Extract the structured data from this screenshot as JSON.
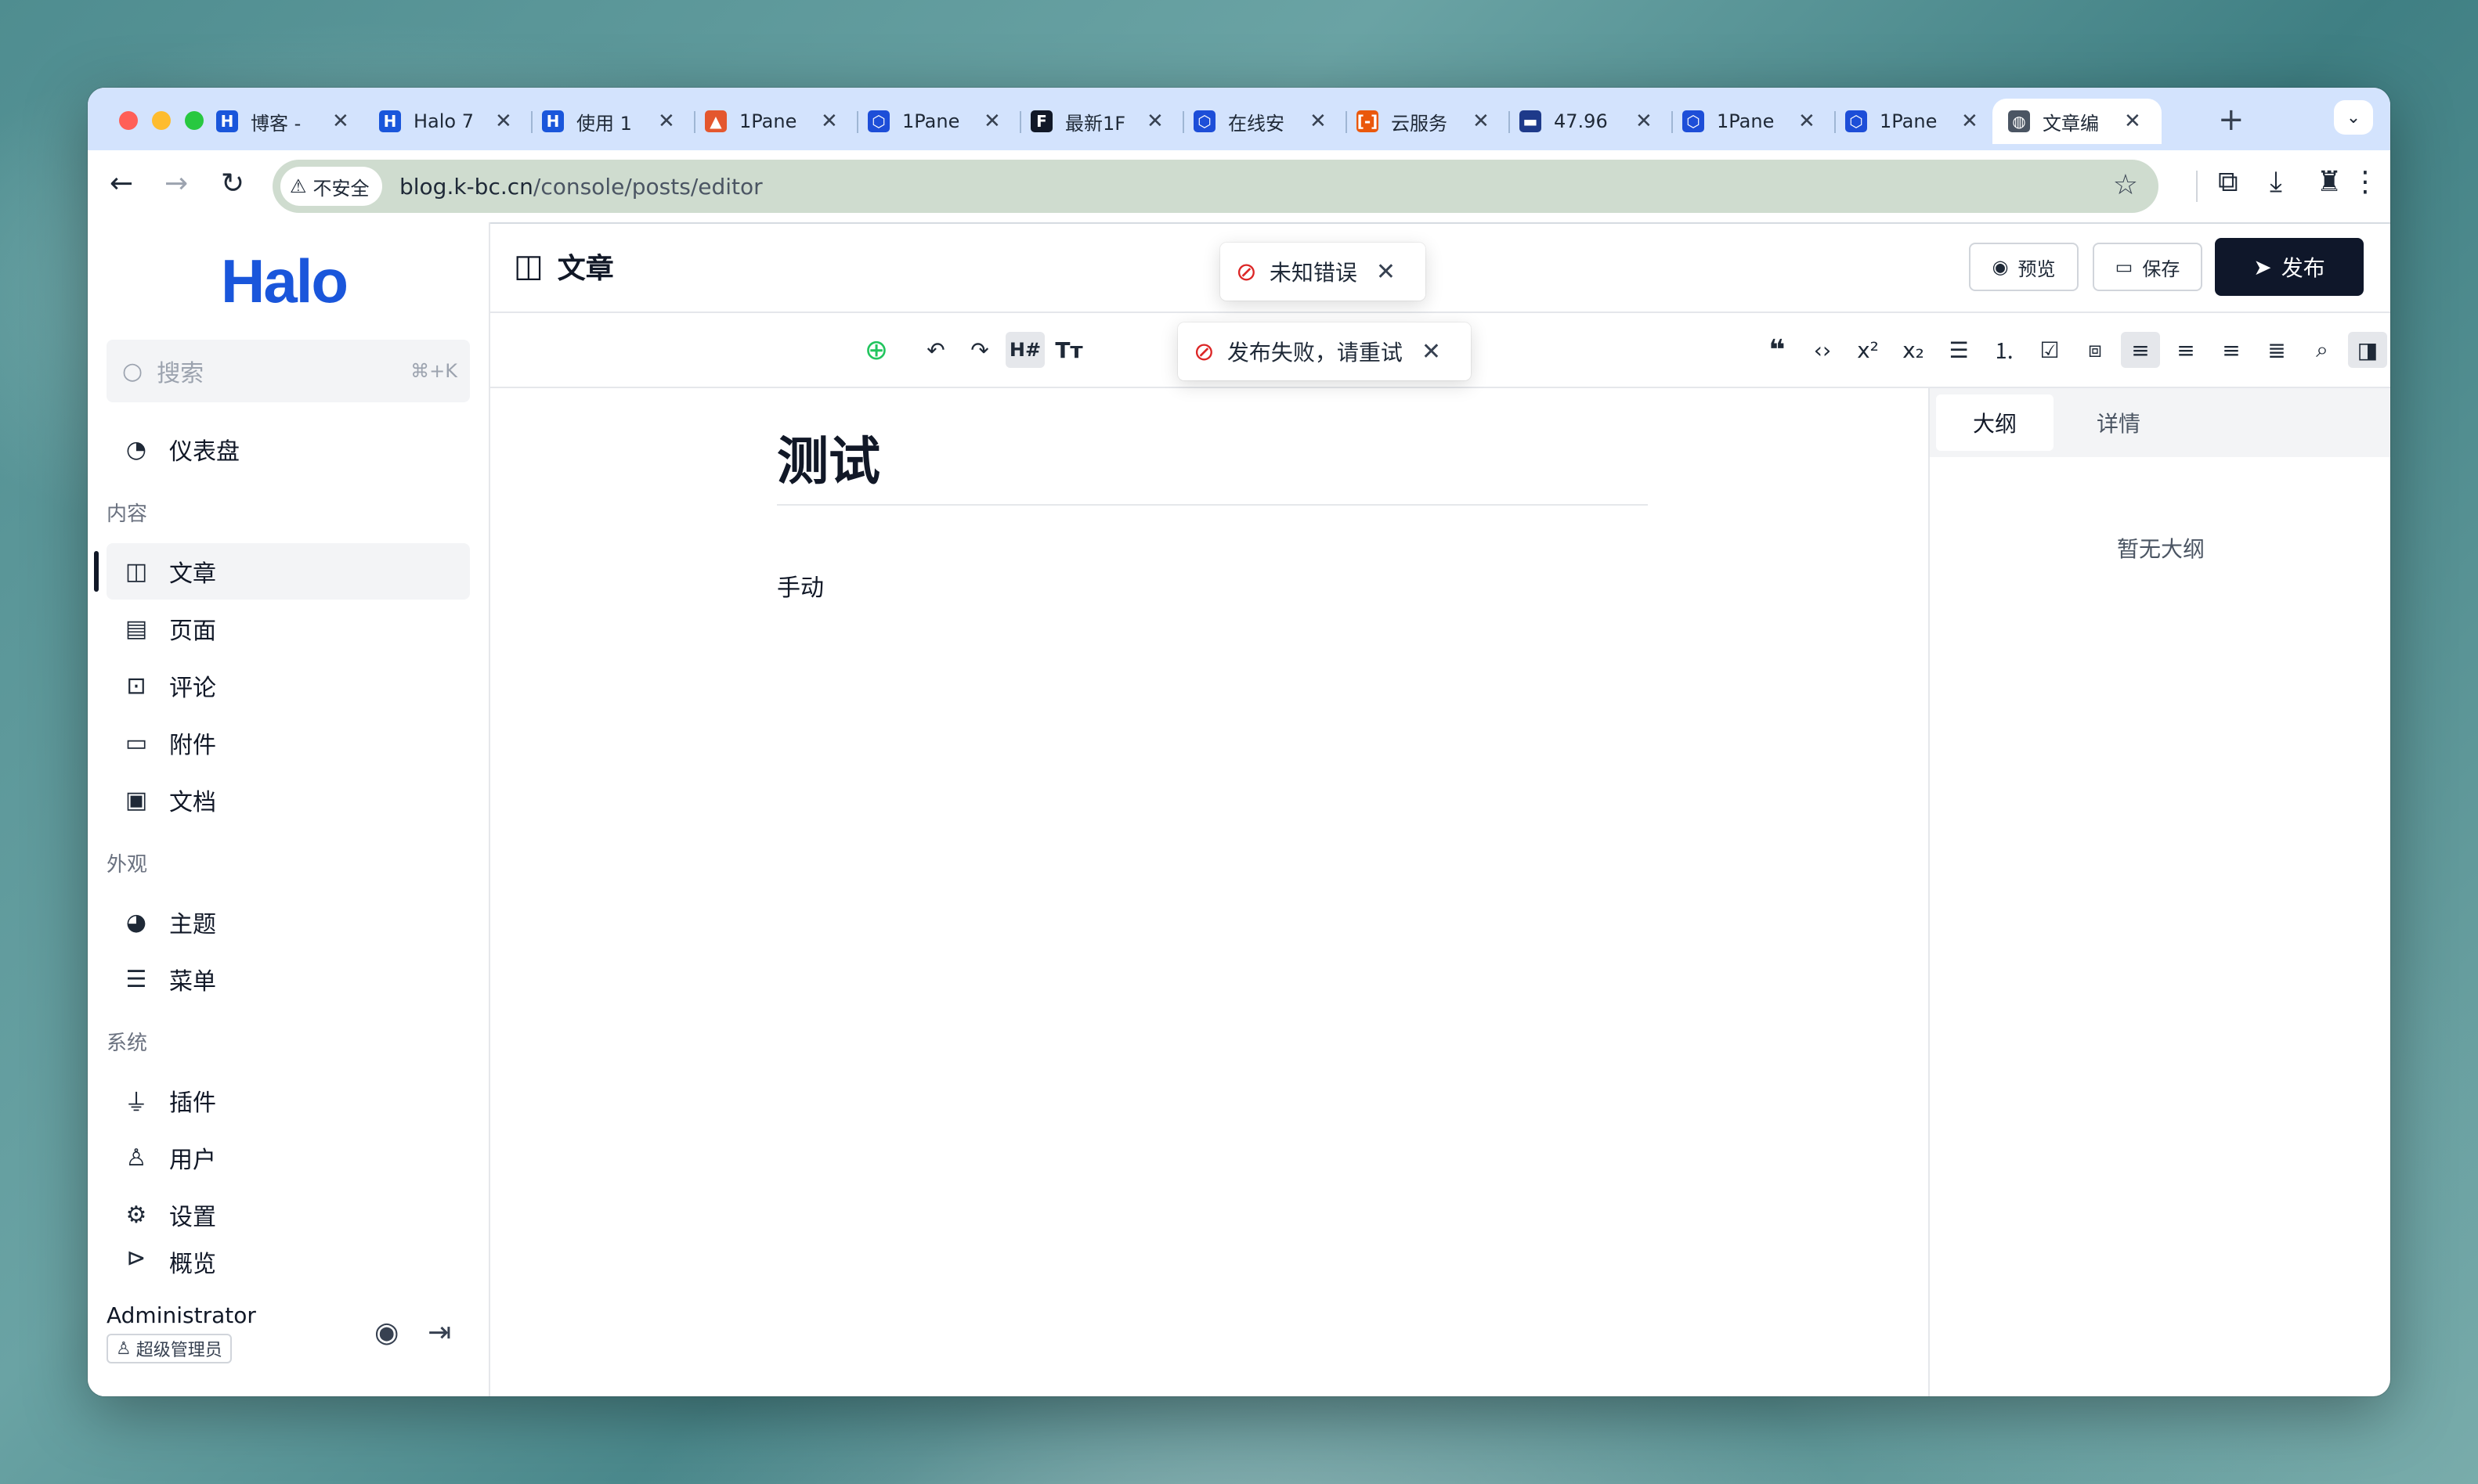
{
  "browser": {
    "tabs": [
      {
        "label": "博客 - ",
        "fav": "H",
        "color": "#1a56db"
      },
      {
        "label": "Halo 7",
        "fav": "H",
        "color": "#1a56db"
      },
      {
        "label": "使用 1",
        "fav": "H",
        "color": "#1a56db"
      },
      {
        "label": "1Pane",
        "fav": "▲",
        "color": "#e4572e"
      },
      {
        "label": "1Pane",
        "fav": "⬡",
        "color": "#1d4ed8"
      },
      {
        "label": "最新1F",
        "fav": "F",
        "color": "#111827"
      },
      {
        "label": "在线安",
        "fav": "⬡",
        "color": "#1d4ed8"
      },
      {
        "label": "云服务",
        "fav": "[-]",
        "color": "#ea580c"
      },
      {
        "label": "47.96",
        "fav": "▬",
        "color": "#1e3a8a"
      },
      {
        "label": "1Pane",
        "fav": "⬡",
        "color": "#1d4ed8"
      },
      {
        "label": "1Pane",
        "fav": "⬡",
        "color": "#1d4ed8"
      },
      {
        "label": "文章编",
        "fav": "◍",
        "color": "#4b5563"
      }
    ],
    "security_label": "不安全",
    "url_domain": "blog.k-bc.cn",
    "url_path": "/console/posts/editor"
  },
  "sidebar": {
    "logo": "Halo",
    "search_placeholder": "搜索",
    "search_shortcut": "⌘+K",
    "dashboard": "仪表盘",
    "group_content": "内容",
    "posts": "文章",
    "pages": "页面",
    "comments": "评论",
    "attachments": "附件",
    "docs": "文档",
    "group_appearance": "外观",
    "themes": "主题",
    "menus": "菜单",
    "group_system": "系统",
    "plugins": "插件",
    "users": "用户",
    "settings": "设置",
    "overview": "概览",
    "user_name": "Administrator",
    "user_role": "超级管理员"
  },
  "header": {
    "title": "文章",
    "preview": "预览",
    "save": "保存",
    "publish": "发布"
  },
  "toasts": {
    "error1": "未知错误",
    "error2": "发布失败，请重试"
  },
  "editor": {
    "title": "测试",
    "body": "手动"
  },
  "panel": {
    "tab_outline": "大纲",
    "tab_detail": "详情",
    "empty_outline": "暂无大纲"
  }
}
